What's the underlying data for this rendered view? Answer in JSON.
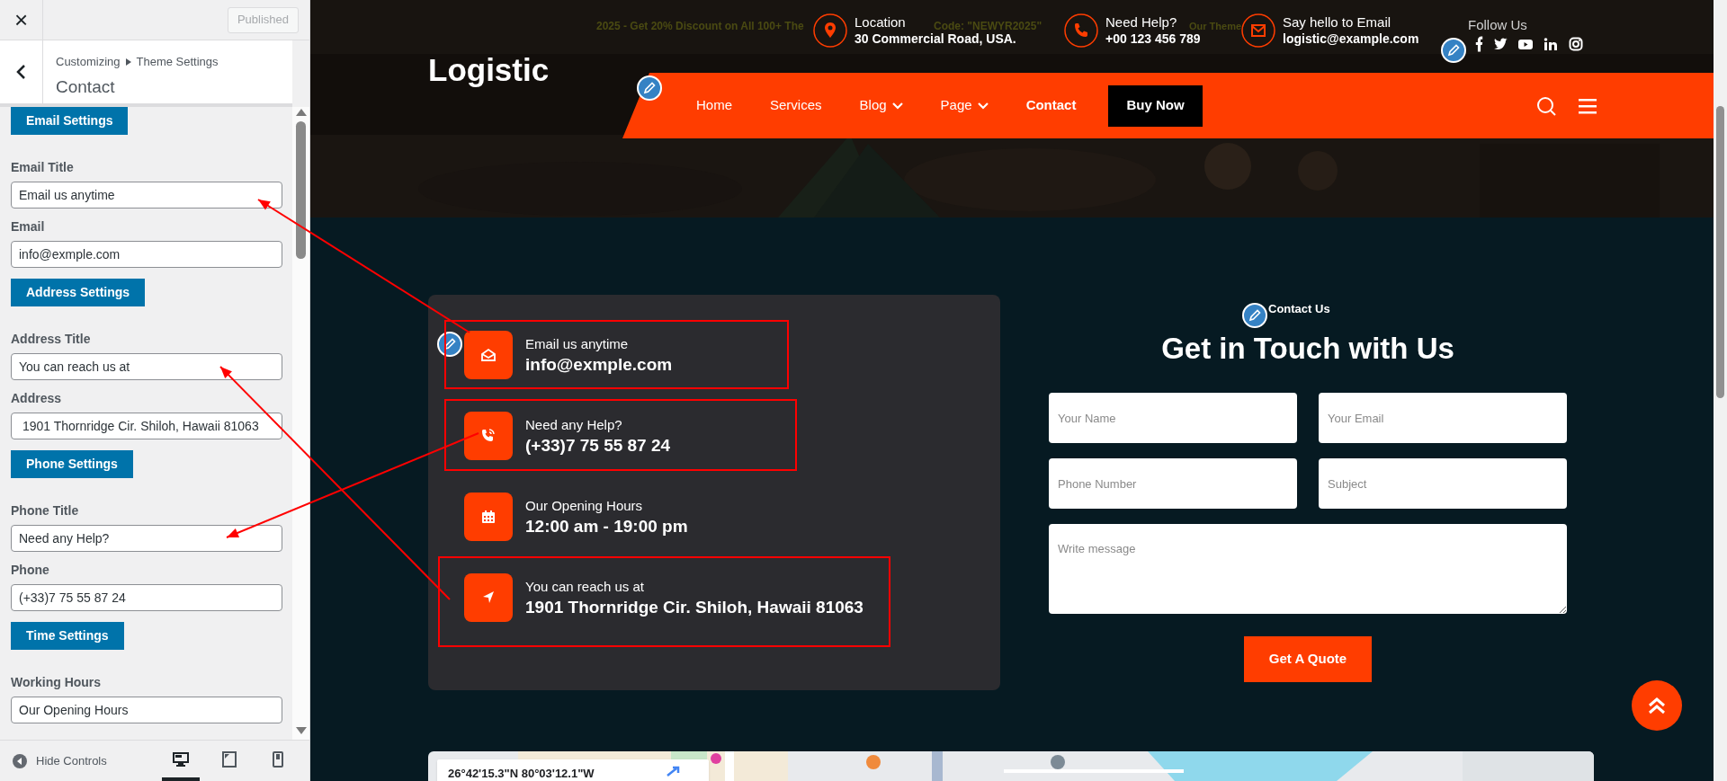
{
  "customizer": {
    "close": "×",
    "publish_button": {
      "label": "Published",
      "disabled": true
    },
    "breadcrumb": [
      "Customizing",
      "Theme Settings"
    ],
    "section_title": "Contact",
    "controls": [
      {
        "kind": "heading",
        "label": "Email Settings"
      },
      {
        "kind": "text",
        "label": "Email Title",
        "value": "Email us anytime"
      },
      {
        "kind": "text",
        "label": "Email",
        "value": "info@exmple.com"
      },
      {
        "kind": "heading",
        "label": "Address Settings"
      },
      {
        "kind": "text",
        "label": "Address Title",
        "value": "You can reach us at"
      },
      {
        "kind": "text",
        "label": "Address",
        "value": " 1901 Thornridge Cir. Shiloh, Hawaii 81063"
      },
      {
        "kind": "heading",
        "label": "Phone Settings"
      },
      {
        "kind": "text",
        "label": "Phone Title",
        "value": "Need any Help?"
      },
      {
        "kind": "text",
        "label": "Phone",
        "value": "(+33)7 75 55 87 24"
      },
      {
        "kind": "heading",
        "label": "Time Settings"
      },
      {
        "kind": "text",
        "label": "Working Hours",
        "value": "Our Opening Hours"
      }
    ],
    "footer": {
      "hide_controls": "Hide Controls",
      "devices": [
        {
          "kind": "desktop",
          "selected": true
        },
        {
          "kind": "tablet",
          "selected": false
        },
        {
          "kind": "mobile",
          "selected": false
        }
      ]
    }
  },
  "site": {
    "promo": [
      "2025 - Get 20% Discount on All 100+ The",
      "Code: \"NEWYR2025\"",
      "Our Theme"
    ],
    "top_info": [
      {
        "kind": "location",
        "label": "Location",
        "value": "30 Commercial Road, USA."
      },
      {
        "kind": "phone",
        "label": "Need Help?",
        "value": "+00 123 456 789"
      },
      {
        "kind": "email",
        "label": "Say hello to Email",
        "value": "logistic@example.com"
      }
    ],
    "follow_label": "Follow Us",
    "socials": [
      {
        "kind": "facebook"
      },
      {
        "kind": "twitter"
      },
      {
        "kind": "youtube"
      },
      {
        "kind": "linkedin"
      },
      {
        "kind": "instagram"
      }
    ],
    "logo": "Logistic",
    "nav": [
      {
        "label": "Home",
        "dropdown": false,
        "selected": false
      },
      {
        "label": "Services",
        "dropdown": false,
        "selected": false
      },
      {
        "label": "Blog",
        "dropdown": true,
        "selected": false
      },
      {
        "label": "Page",
        "dropdown": true,
        "selected": false
      },
      {
        "label": "Contact",
        "dropdown": false,
        "selected": true
      }
    ],
    "buy_now": "Buy Now",
    "contact_items": [
      {
        "kind": "email",
        "title": "Email us anytime",
        "value": "info@exmple.com"
      },
      {
        "kind": "phone",
        "title": "Need any Help?",
        "value": "(+33)7 75 55 87 24"
      },
      {
        "kind": "calendar",
        "title": "Our Opening Hours",
        "value": "12:00 am - 19:00 pm"
      },
      {
        "kind": "location",
        "title": "You can reach us at",
        "value": "1901 Thornridge Cir. Shiloh, Hawaii 81063"
      }
    ],
    "form": {
      "eyebrow": "Contact Us",
      "heading": "Get in Touch with Us",
      "fields": [
        {
          "kind": "input",
          "placeholder": "Your Name"
        },
        {
          "kind": "input",
          "placeholder": "Your Email"
        },
        {
          "kind": "input",
          "placeholder": "Phone Number"
        },
        {
          "kind": "input",
          "placeholder": "Subject"
        },
        {
          "kind": "textarea",
          "placeholder": "Write message"
        }
      ],
      "submit": "Get A Quote"
    },
    "map": {
      "kind": "picture",
      "coordinates": "26°42'15.3\"N 80°03'12.1\"W"
    }
  }
}
